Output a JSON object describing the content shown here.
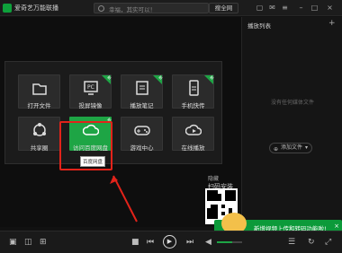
{
  "app": {
    "title": "爱奇艺万能联播",
    "search_placeholder": "幸福，其实可以！",
    "search_button": "搜全网"
  },
  "sidebar": {
    "title": "播放列表",
    "empty": "没有任何媒体文件",
    "add_file": "添加文件"
  },
  "tools": [
    {
      "label": "打开文件",
      "icon": "folder-icon",
      "new": false
    },
    {
      "label": "投屏镜像",
      "icon": "pc-screen-icon",
      "new": true
    },
    {
      "label": "播放笔记",
      "icon": "note-icon",
      "new": true
    },
    {
      "label": "手机快传",
      "icon": "phone-transfer-icon",
      "new": true
    },
    {
      "label": "共享圈",
      "icon": "share-circle-icon",
      "new": false
    },
    {
      "label": "访问百度网盘",
      "icon": "cloud-icon",
      "new": true
    },
    {
      "label": "游戏中心",
      "icon": "gamepad-icon",
      "new": false
    },
    {
      "label": "在线播放",
      "icon": "cloud-play-icon",
      "new": false
    }
  ],
  "new_badge": "新",
  "tooltip": "百度网盘",
  "qr": {
    "caption": "扫码安装",
    "close": "隐藏"
  },
  "promo": {
    "text": "新增视频上传和转码功能啦!"
  },
  "accent": "#1ea545",
  "highlight": "#e2231a"
}
